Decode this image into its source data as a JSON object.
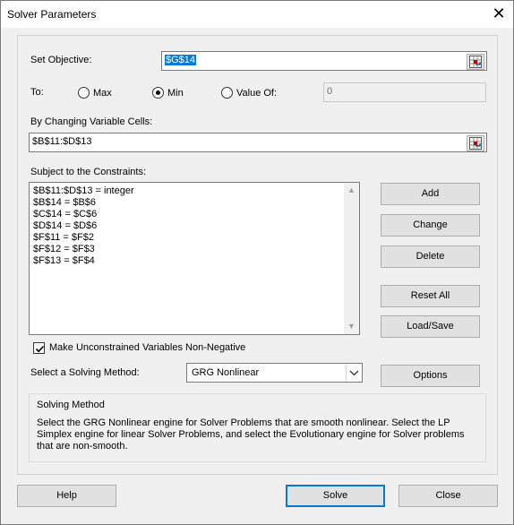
{
  "window": {
    "title": "Solver Parameters",
    "close_glyph": "✕"
  },
  "objective": {
    "label": "Set Objective:",
    "value": "$G$14"
  },
  "to": {
    "label": "To:",
    "options": [
      {
        "label": "Max",
        "selected": false
      },
      {
        "label": "Min",
        "selected": true
      },
      {
        "label": "Value Of:",
        "selected": false
      }
    ],
    "value_of": "0"
  },
  "changing_cells": {
    "label": "By Changing Variable Cells:",
    "value": "$B$11:$D$13"
  },
  "constraints": {
    "label": "Subject to the Constraints:",
    "items": [
      "$B$11:$D$13 = integer",
      "$B$14 = $B$6",
      "$C$14 = $C$6",
      "$D$14 = $D$6",
      "$F$11 = $F$2",
      "$F$12 = $F$3",
      "$F$13 = $F$4"
    ]
  },
  "buttons": {
    "add": "Add",
    "change": "Change",
    "delete": "Delete",
    "reset_all": "Reset All",
    "load_save": "Load/Save",
    "options": "Options",
    "help": "Help",
    "solve": "Solve",
    "close": "Close"
  },
  "nonneg": {
    "label": "Make Unconstrained Variables Non-Negative",
    "checked": true
  },
  "method": {
    "label": "Select a Solving Method:",
    "value": "GRG Nonlinear"
  },
  "solving_method": {
    "title": "Solving Method",
    "description": "Select the GRG Nonlinear engine for Solver Problems that are smooth nonlinear. Select the LP Simplex engine for linear Solver Problems, and select the Evolutionary engine for Solver problems that are non-smooth."
  },
  "colors": {
    "accent": "#0078d7",
    "face": "#f0f0f0",
    "button": "#e1e1e1"
  }
}
